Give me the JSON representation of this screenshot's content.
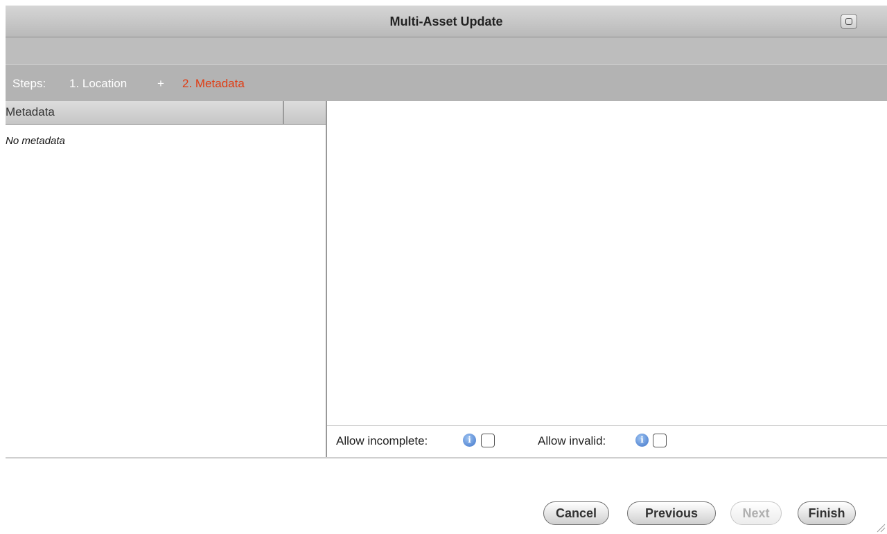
{
  "window": {
    "title": "Multi-Asset Update"
  },
  "steps": {
    "prefix": "Steps:",
    "items": [
      {
        "label": "1. Location",
        "state": "done"
      },
      {
        "label": "2. Metadata",
        "state": "current"
      }
    ],
    "separator": "+"
  },
  "metadata_panel": {
    "column_header": "Metadata",
    "empty_message": "No metadata"
  },
  "options": {
    "allow_incomplete_label": "Allow incomplete:",
    "allow_incomplete_checked": false,
    "allow_invalid_label": "Allow invalid:",
    "allow_invalid_checked": false,
    "info_icon": "info-icon"
  },
  "buttons": {
    "cancel": "Cancel",
    "previous": "Previous",
    "next": "Next",
    "finish": "Finish"
  },
  "colors": {
    "current_step": "#e03b12",
    "info_icon": "#3f74c9"
  }
}
